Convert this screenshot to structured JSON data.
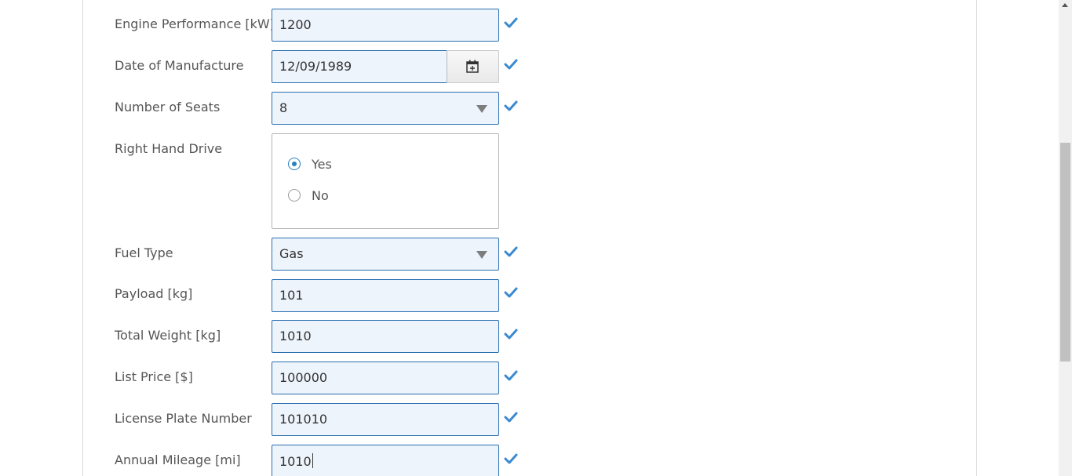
{
  "form": {
    "engine_performance": {
      "label": "Engine Performance [kW]",
      "value": "1200"
    },
    "date_of_manufacture": {
      "label": "Date of Manufacture",
      "value": "12/09/1989",
      "button_icon": "calendar-icon"
    },
    "number_of_seats": {
      "label": "Number of Seats",
      "value": "8"
    },
    "right_hand_drive": {
      "label": "Right Hand Drive",
      "options": [
        {
          "label": "Yes",
          "checked": true
        },
        {
          "label": "No",
          "checked": false
        }
      ]
    },
    "fuel_type": {
      "label": "Fuel Type",
      "value": "Gas"
    },
    "payload": {
      "label": "Payload [kg]",
      "value": "101"
    },
    "total_weight": {
      "label": "Total Weight [kg]",
      "value": "1010"
    },
    "list_price": {
      "label": "List Price [$]",
      "value": "100000"
    },
    "license_plate_number": {
      "label": "License Plate Number",
      "value": "101010"
    },
    "annual_mileage": {
      "label": "Annual Mileage [mi]",
      "value": "1010"
    }
  },
  "icons": {
    "valid": "checkmark-icon",
    "dropdown": "chevron-down-icon"
  },
  "colors": {
    "field_border": "#2a6fb0",
    "field_background": "#eef4fc",
    "valid_check": "#3a8ad0",
    "label_text": "#555555"
  }
}
